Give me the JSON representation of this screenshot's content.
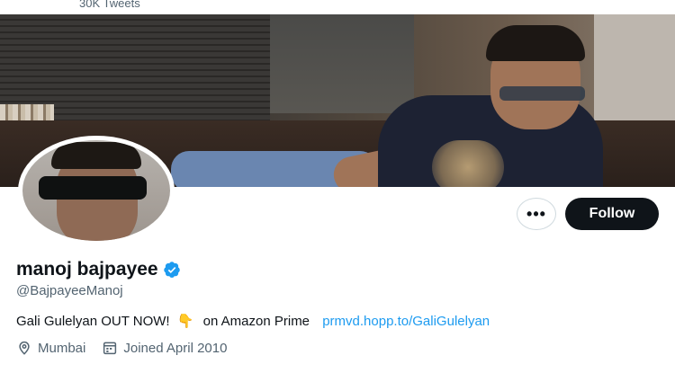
{
  "header": {
    "tweet_count": "30K Tweets"
  },
  "profile": {
    "display_name": "manoj bajpayee",
    "handle": "@BajpayeeManoj",
    "verified": true,
    "bio_text": "Gali Gulelyan OUT NOW!",
    "bio_emoji": "👇",
    "bio_suffix": "on Amazon Prime",
    "bio_link": "prmvd.hopp.to/GaliGulelyan",
    "location": "Mumbai",
    "joined": "Joined April 2010"
  },
  "actions": {
    "more_label": "•••",
    "follow_label": "Follow"
  },
  "icons": {
    "more": "more-icon",
    "verified": "verified-badge-icon",
    "location": "location-pin-icon",
    "calendar": "calendar-icon"
  },
  "colors": {
    "accent": "#1d9bf0",
    "follow_bg": "#0f1419",
    "muted": "#536471"
  }
}
